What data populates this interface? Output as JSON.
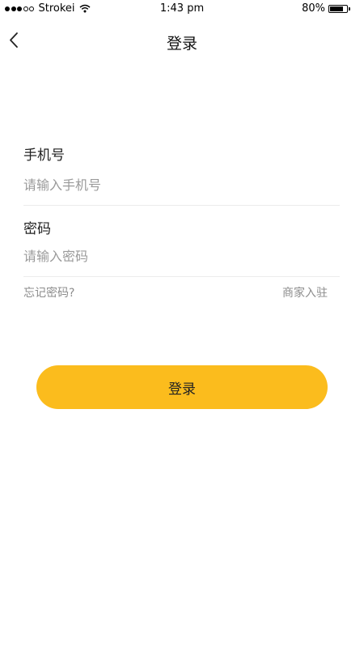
{
  "status_bar": {
    "carrier": "Strokei",
    "time": "1:43 pm",
    "battery": "80%",
    "battery_level": 0.8,
    "signal_icon": "signal-dots-icon",
    "wifi_icon": "wifi-icon",
    "battery_icon": "battery-icon"
  },
  "nav": {
    "title": "登录",
    "back_icon": "chevron-left-icon"
  },
  "form": {
    "phone_label": "手机号",
    "phone_placeholder": "请输入手机号",
    "password_label": "密码",
    "password_placeholder": "请输入密码"
  },
  "links": {
    "forgot_password": "忘记密码?",
    "merchant_join": "商家入驻"
  },
  "login_button": "登录",
  "colors": {
    "accent": "#fbbc1d",
    "placeholder": "#9a9a9a",
    "link": "#8c8c8c",
    "divider": "#ececec"
  }
}
